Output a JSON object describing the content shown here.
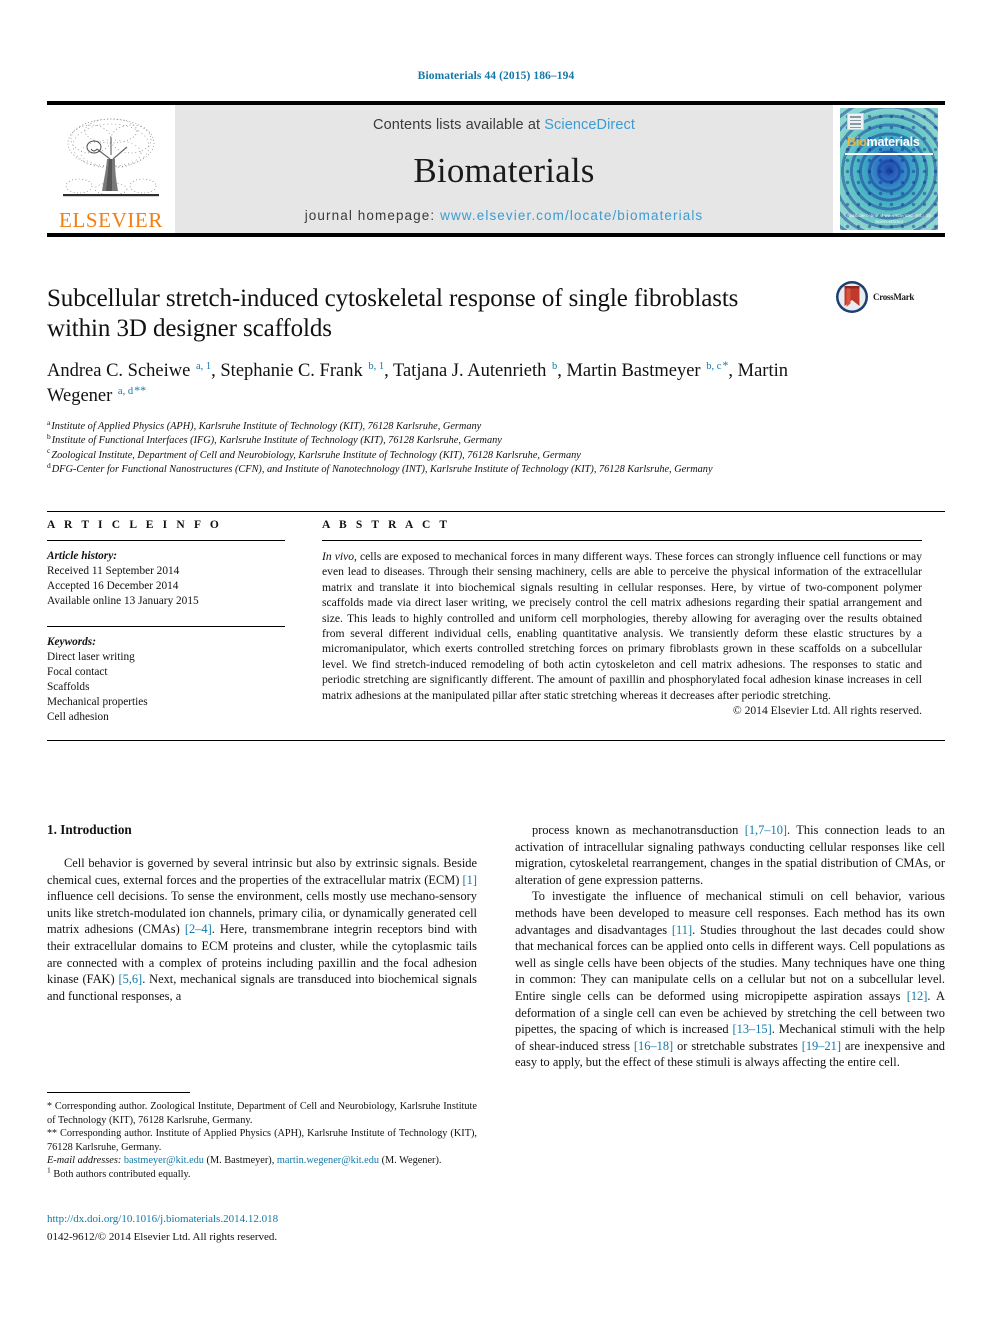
{
  "running_head": "Biomaterials 44 (2015) 186–194",
  "masthead": {
    "contents_prefix": "Contents lists available at ",
    "sciencedirect": "ScienceDirect",
    "journal_name": "Biomaterials",
    "homepage_prefix": "journal homepage: ",
    "homepage_url": "www.elsevier.com/locate/biomaterials",
    "publisher": "ELSEVIER",
    "cover": {
      "title_part1": "Bio",
      "title_part2": "materials",
      "footer_line1": "Available online at www.sciencedirect.com",
      "footer_line2": "ScienceDirect"
    },
    "colors": {
      "link": "#3c9cd1",
      "elsevier_orange": "#f07f13",
      "band_gray": "#e6e6e6",
      "running_head_blue": "#1278a8"
    }
  },
  "title": "Subcellular stretch-induced cytoskeletal response of single fibroblasts within 3D designer scaffolds",
  "crossmark_label": "CrossMark",
  "authors_html": "Andrea C. Scheiwe <sup>a, 1</sup>, Stephanie C. Frank <sup>b, 1</sup>, Tatjana J. Autenrieth <sup>b</sup>, Martin Bastmeyer <sup>b, c</sup><sup class=\"star\">*</sup>, Martin Wegener <sup>a, d</sup><sup class=\"star\">**</sup>",
  "affiliations": [
    {
      "marker": "a",
      "text": "Institute of Applied Physics (APH), Karlsruhe Institute of Technology (KIT), 76128 Karlsruhe, Germany"
    },
    {
      "marker": "b",
      "text": "Institute of Functional Interfaces (IFG), Karlsruhe Institute of Technology (KIT), 76128 Karlsruhe, Germany"
    },
    {
      "marker": "c",
      "text": "Zoological Institute, Department of Cell and Neurobiology, Karlsruhe Institute of Technology (KIT), 76128 Karlsruhe, Germany"
    },
    {
      "marker": "d",
      "text": "DFG-Center for Functional Nanostructures (CFN), and Institute of Nanotechnology (INT), Karlsruhe Institute of Technology (KIT), 76128 Karlsruhe, Germany"
    }
  ],
  "article_info": {
    "heading": "A R T I C L E   I N F O",
    "history_label": "Article history:",
    "history": [
      "Received 11 September 2014",
      "Accepted 16 December 2014",
      "Available online 13 January 2015"
    ],
    "keywords_label": "Keywords:",
    "keywords": [
      "Direct laser writing",
      "Focal contact",
      "Scaffolds",
      "Mechanical properties",
      "Cell adhesion"
    ]
  },
  "abstract": {
    "heading": "A B S T R A C T",
    "lead_italic": "In vivo",
    "body": ", cells are exposed to mechanical forces in many different ways. These forces can strongly influence cell functions or may even lead to diseases. Through their sensing machinery, cells are able to perceive the physical information of the extracellular matrix and translate it into biochemical signals resulting in cellular responses. Here, by virtue of two-component polymer scaffolds made via direct laser writing, we precisely control the cell matrix adhesions regarding their spatial arrangement and size. This leads to highly controlled and uniform cell morphologies, thereby allowing for averaging over the results obtained from several different individual cells, enabling quantitative analysis. We transiently deform these elastic structures by a micromanipulator, which exerts controlled stretching forces on primary fibroblasts grown in these scaffolds on a subcellular level. We find stretch-induced remodeling of both actin cytoskeleton and cell matrix adhesions. The responses to static and periodic stretching are significantly different. The amount of paxillin and phosphorylated focal adhesion kinase increases in cell matrix adhesions at the manipulated pillar after static stretching whereas it decreases after periodic stretching.",
    "copyright": "© 2014 Elsevier Ltd. All rights reserved."
  },
  "section": {
    "number_title": "1. Introduction",
    "left_para_html": "Cell behavior is governed by several intrinsic but also by extrinsic signals. Beside chemical cues, external forces and the properties of the extracellular matrix (ECM) <span class=\"ref\">[1]</span> influence cell decisions. To sense the environment, cells mostly use mechano-sensory units like stretch-modulated ion channels, primary cilia, or dynamically generated cell matrix adhesions (CMAs) <span class=\"ref\">[2&#8211;4]</span>. Here, transmembrane integrin receptors bind with their extracellular domains to ECM proteins and cluster, while the cytoplasmic tails are connected with a complex of proteins including paxillin and the focal adhesion kinase (FAK) <span class=\"ref\">[5,6]</span>. Next, mechanical signals are transduced into biochemical signals and functional responses, a",
    "right_para1_html": "process known as mechanotransduction <span class=\"ref\">[1,7&#8211;10]</span>. This connection leads to an activation of intracellular signaling pathways conducting cellular responses like cell migration, cytoskeletal rearrangement, changes in the spatial distribution of CMAs, or alteration of gene expression patterns.",
    "right_para2_html": "To investigate the influence of mechanical stimuli on cell behavior, various methods have been developed to measure cell responses. Each method has its own advantages and disadvantages <span class=\"ref\">[11]</span>. Studies throughout the last decades could show that mechanical forces can be applied onto cells in different ways. Cell populations as well as single cells have been objects of the studies. Many techniques have one thing in common: They can manipulate cells on a cellular but not on a subcellular level. Entire single cells can be deformed using micropipette aspiration assays <span class=\"ref\">[12]</span>. A deformation of a single cell can even be achieved by stretching the cell between two pipettes, the spacing of which is increased <span class=\"ref\">[13&#8211;15]</span>. Mechanical stimuli with the help of shear-induced stress <span class=\"ref\">[16&#8211;18]</span> or stretchable substrates <span class=\"ref\">[19&#8211;21]</span> are inexpensive and easy to apply, but the effect of these stimuli is always affecting the entire cell."
  },
  "footnotes": {
    "corr1_html": "<span class=\"star\">*</span> Corresponding author. Zoological Institute, Department of Cell and Neurobiology, Karlsruhe Institute of Technology (KIT), 76128 Karlsruhe, Germany.",
    "corr2_html": "<span class=\"star\">**</span> Corresponding author. Institute of Applied Physics (APH), Karlsruhe Institute of Technology (KIT), 76128 Karlsruhe, Germany.",
    "email_html": "<i>E-mail addresses:</i> <span class=\"lnk\">bastmeyer@kit.edu</span> (M. Bastmeyer), <span class=\"lnk\">martin.wegener@kit.edu</span> (M. Wegener).",
    "equal_html": "<sup>1</sup> Both authors contributed equally."
  },
  "footer": {
    "doi": "http://dx.doi.org/10.1016/j.biomaterials.2014.12.018",
    "issn_line": "0142-9612/© 2014 Elsevier Ltd. All rights reserved."
  }
}
